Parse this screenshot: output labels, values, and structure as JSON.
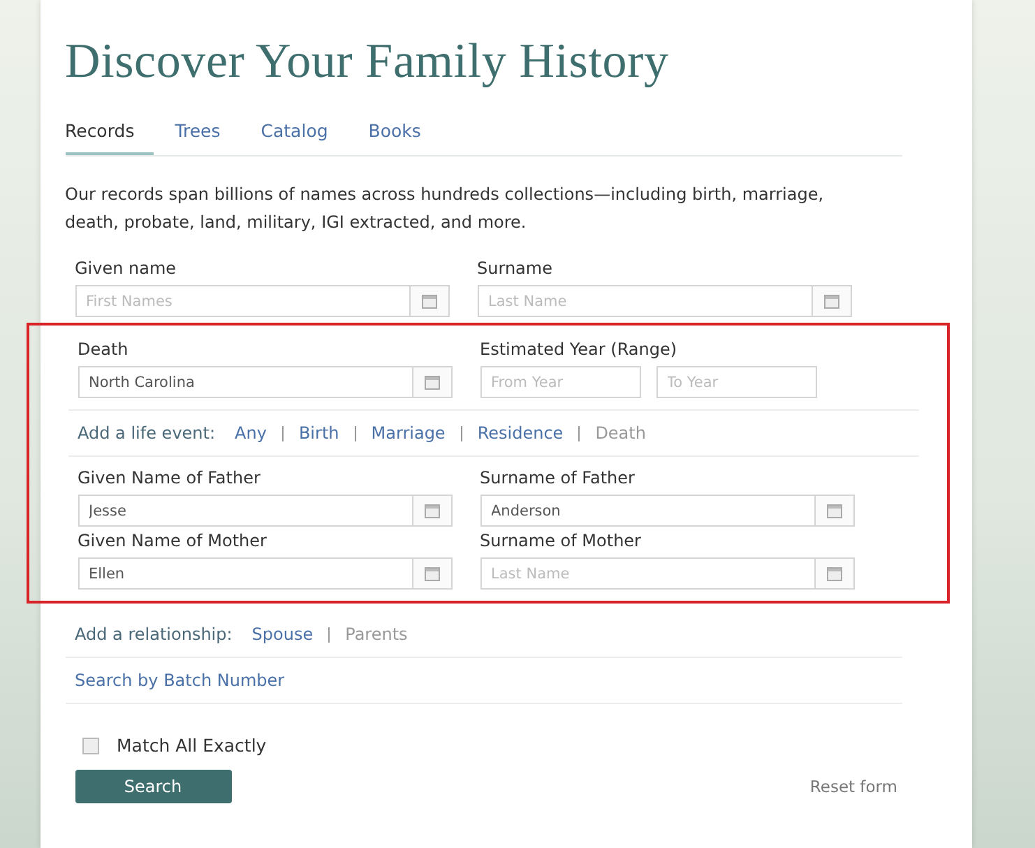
{
  "title": "Discover Your Family History",
  "tabs": [
    {
      "label": "Records",
      "selected": true
    },
    {
      "label": "Trees",
      "selected": false
    },
    {
      "label": "Catalog",
      "selected": false
    },
    {
      "label": "Books",
      "selected": false
    }
  ],
  "intro": "Our records span billions of names across hundreds collections—including birth, marriage, death, probate, land, military, IGI extracted, and more.",
  "name_fields": [
    {
      "label": "Given name",
      "placeholder": "First Names"
    },
    {
      "label": "Surname",
      "placeholder": "Last Name"
    }
  ],
  "highlighted_section": {
    "highlighted": true,
    "event_place": {
      "label": "Death",
      "value": "North Carolina"
    },
    "year_range": {
      "label": "Estimated Year (Range)",
      "from": {
        "placeholder": "From Year"
      },
      "to": {
        "placeholder": "To Year"
      }
    },
    "life_event": {
      "label": "Add a life event:",
      "options": [
        {
          "label": "Any",
          "selected": false
        },
        {
          "label": "Birth",
          "selected": false
        },
        {
          "label": "Marriage",
          "selected": false
        },
        {
          "label": "Residence",
          "selected": false
        },
        {
          "label": "Death",
          "selected": true
        }
      ]
    },
    "parent_fields": [
      {
        "label": "Given Name of Father",
        "value": "Jesse"
      },
      {
        "label": "Surname of Father",
        "value": "Anderson"
      },
      {
        "label": "Given Name of Mother",
        "value": "Ellen"
      },
      {
        "label": "Surname of Mother",
        "placeholder": "Last Name"
      }
    ]
  },
  "relationship": {
    "label": "Add a relationship:",
    "options": [
      {
        "label": "Spouse",
        "selected": false
      },
      {
        "label": "Parents",
        "selected": true
      }
    ]
  },
  "batch_link": "Search by Batch Number",
  "match_exactly": {
    "label": "Match All Exactly",
    "checked": false
  },
  "search_button": "Search",
  "reset_link": "Reset form"
}
